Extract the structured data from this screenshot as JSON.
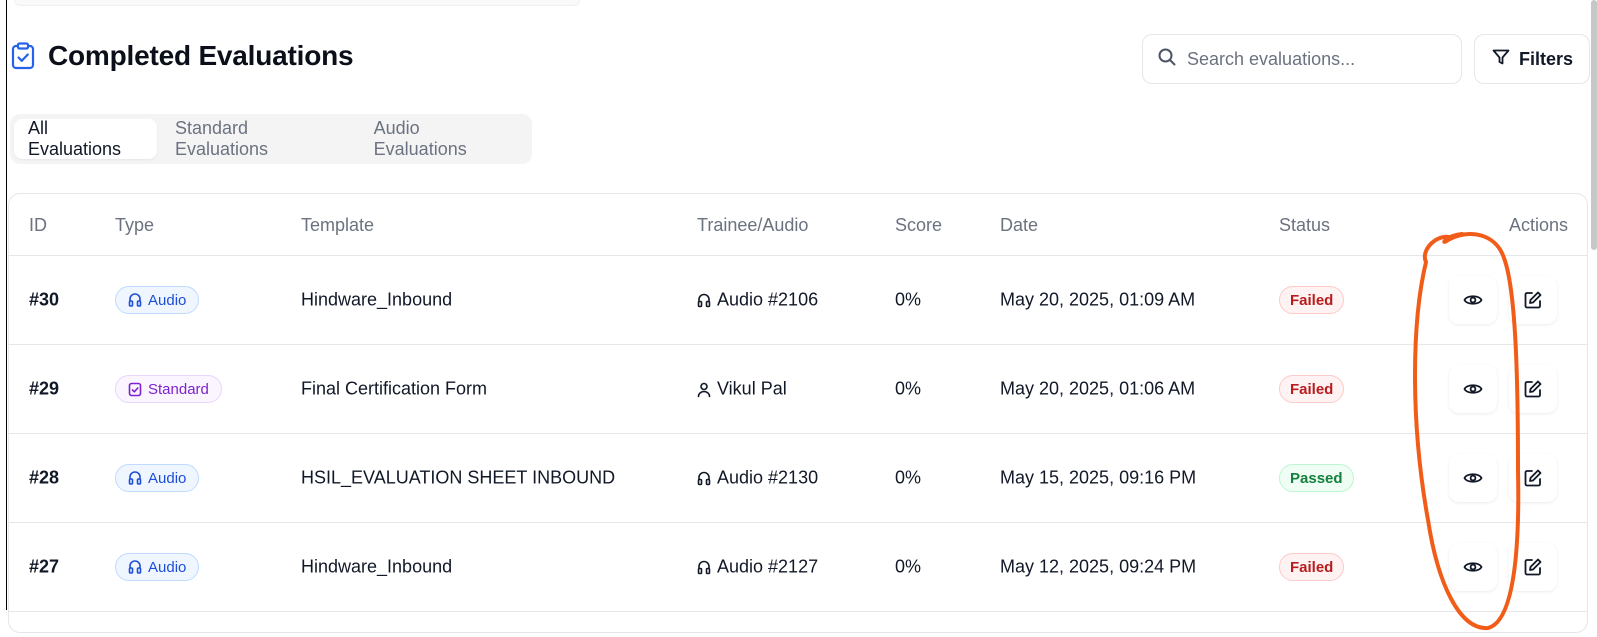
{
  "header": {
    "title": "Completed Evaluations",
    "title_icon": "clipboard-check-icon",
    "search_placeholder": "Search evaluations...",
    "filters_label": "Filters"
  },
  "tabs": [
    {
      "label": "All Evaluations",
      "active": true
    },
    {
      "label": "Standard Evaluations",
      "active": false
    },
    {
      "label": "Audio Evaluations",
      "active": false
    }
  ],
  "table": {
    "columns": [
      "ID",
      "Type",
      "Template",
      "Trainee/Audio",
      "Score",
      "Date",
      "Status",
      "Actions"
    ],
    "rows": [
      {
        "id": "#30",
        "type": "Audio",
        "template": "Hindware_Inbound",
        "trainee": "Audio #2106",
        "trainee_kind": "audio",
        "score": "0%",
        "date": "May 20, 2025, 01:09 AM",
        "status": "Failed"
      },
      {
        "id": "#29",
        "type": "Standard",
        "template": "Final Certification Form",
        "trainee": "Vikul Pal",
        "trainee_kind": "user",
        "score": "0%",
        "date": "May 20, 2025, 01:06 AM",
        "status": "Failed"
      },
      {
        "id": "#28",
        "type": "Audio",
        "template": "HSIL_EVALUATION SHEET INBOUND",
        "trainee": "Audio #2130",
        "trainee_kind": "audio",
        "score": "0%",
        "date": "May 15, 2025, 09:16 PM",
        "status": "Passed"
      },
      {
        "id": "#27",
        "type": "Audio",
        "template": "Hindware_Inbound",
        "trainee": "Audio #2127",
        "trainee_kind": "audio",
        "score": "0%",
        "date": "May 12, 2025, 09:24 PM",
        "status": "Failed"
      }
    ]
  },
  "colors": {
    "audio_badge": "#1d4ed8",
    "standard_badge": "#7e22ce",
    "failed": "#b91c1c",
    "passed": "#15803d",
    "annotation": "#f25c19"
  }
}
